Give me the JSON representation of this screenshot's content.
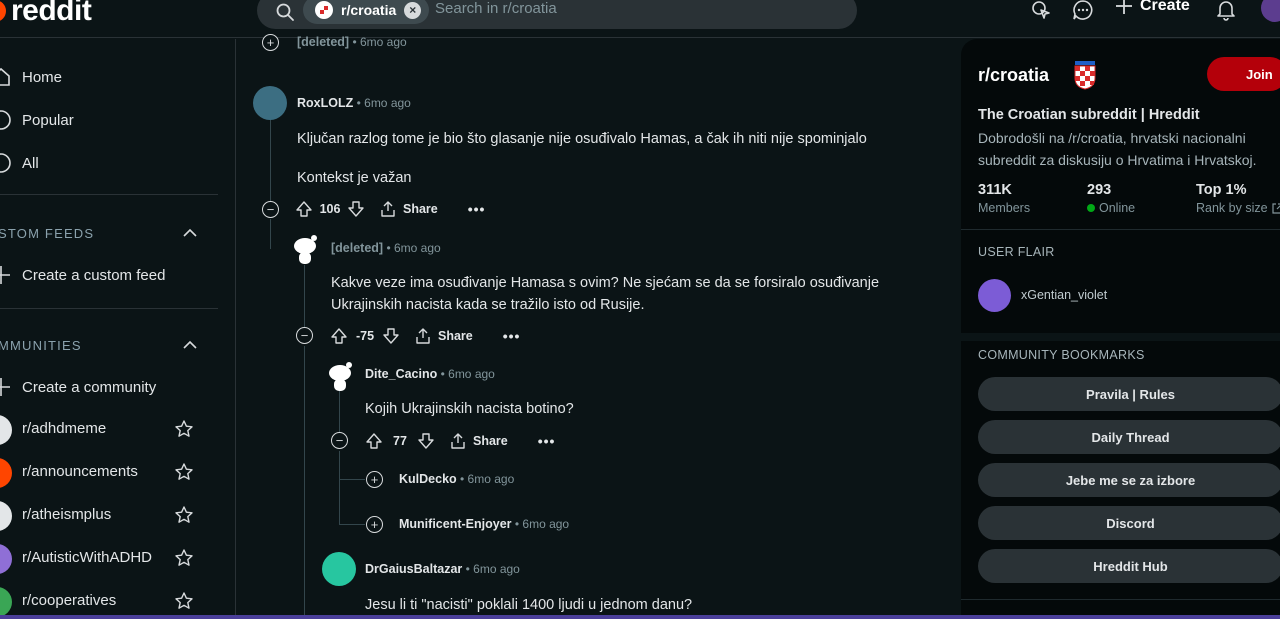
{
  "header": {
    "logo_text": "reddit",
    "search_chip_label": "r/croatia",
    "search_chip_close": "×",
    "search_placeholder": "Search in r/croatia",
    "create_label": "Create"
  },
  "left_nav": {
    "items": [
      {
        "label": "Home",
        "icon": "home-icon"
      },
      {
        "label": "Popular",
        "icon": "popular-icon"
      },
      {
        "label": "All",
        "icon": "all-icon"
      }
    ],
    "custom_feeds_heading": "STOM FEEDS",
    "create_custom_feed_label": "Create a custom feed",
    "communities_heading": "MMUNITIES",
    "create_community_label": "Create a community",
    "communities": [
      {
        "name": "r/adhdmeme",
        "color": "#e3e6e8"
      },
      {
        "name": "r/announcements",
        "color": "#ff4500"
      },
      {
        "name": "r/atheismplus",
        "color": "#e3e6e8"
      },
      {
        "name": "r/AutisticWithADHD",
        "color": "#8f6fd6"
      },
      {
        "name": "r/cooperatives",
        "color": "#3aa655"
      }
    ]
  },
  "comments": [
    {
      "id": "c0",
      "author": "[deleted]",
      "time": "6mo ago",
      "collapsed": true
    },
    {
      "id": "c1",
      "author": "RoxLOLZ",
      "time": "6mo ago",
      "body": [
        "Ključan razlog tome je bio što glasanje nije osuđivalo Hamas, a čak ih niti nije spominjalo",
        "Kontekst je važan"
      ],
      "votes": "106",
      "share_label": "Share",
      "more_label": "•••"
    },
    {
      "id": "c2",
      "author": "[deleted]",
      "time": "6mo ago",
      "body": [
        "Kakve veze ima osuđivanje Hamasa s ovim? Ne sjećam se da se forsiralo osuđivanje Ukrajinskih nacista kada se tražilo isto od Rusije."
      ],
      "votes": "-75",
      "share_label": "Share",
      "more_label": "•••"
    },
    {
      "id": "c3",
      "author": "Dite_Cacino",
      "time": "6mo ago",
      "body": [
        "Kojih Ukrajinskih nacista botino?"
      ],
      "votes": "77",
      "share_label": "Share",
      "more_label": "•••"
    },
    {
      "id": "c4",
      "author": "KulDecko",
      "time": "6mo ago",
      "collapsed": true
    },
    {
      "id": "c5",
      "author": "Munificent-Enjoyer",
      "time": "6mo ago",
      "collapsed": true
    },
    {
      "id": "c6",
      "author": "DrGaiusBaltazar",
      "time": "6mo ago",
      "body": [
        "Jesu li ti \"nacisti\" poklali 1400 ljudi u jednom danu?"
      ]
    }
  ],
  "sidebar": {
    "subreddit": "r/croatia",
    "join_label": "Join",
    "title": "The Croatian subreddit | Hreddit",
    "description": "Dobrodošli na /r/croatia, hrvatski nacionalni subreddit za diskusiju o Hrvatima i Hrvatskoj.",
    "stats": [
      {
        "value": "311K",
        "label": "Members"
      },
      {
        "value": "293",
        "label": "Online"
      },
      {
        "value": "Top 1%",
        "label": "Rank by size"
      }
    ],
    "user_flair_heading": "USER FLAIR",
    "user_flair_name": "xGentian_violet",
    "bookmarks_heading": "COMMUNITY BOOKMARKS",
    "bookmarks": [
      "Pravila | Rules",
      "Daily Thread",
      "Jebe me se za izbore",
      "Discord",
      "Hreddit Hub"
    ]
  },
  "colors": {
    "background": "#0b1416",
    "accent": "#ff4500",
    "join": "#b4000a",
    "online": "#01a816"
  }
}
